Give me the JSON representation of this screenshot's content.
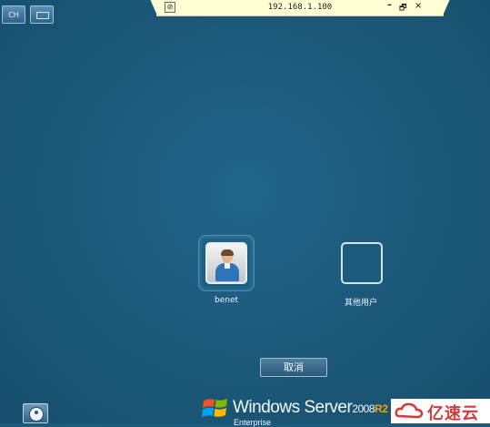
{
  "topbar": {
    "lang_label": "CH",
    "keyboard_icon": "keyboard-icon"
  },
  "connection_bar": {
    "pin_icon": "pin-icon",
    "title": "192.168.1.100",
    "minimize_label": "–",
    "restore_label": "🗗",
    "close_label": "×"
  },
  "users": [
    {
      "name": "benet",
      "icon": "user-avatar-icon"
    },
    {
      "name": "其他用户",
      "icon": "empty-user-tile"
    }
  ],
  "cancel_label": "取消",
  "ease_of_access_icon": "ease-of-access-icon",
  "branding": {
    "product": "Windows Server",
    "version": "2008",
    "release": "R2",
    "edition": "Enterprise",
    "r2_color": "#e5a12a"
  },
  "watermark": {
    "text": "亿速云",
    "color": "#d6393a"
  },
  "colors": {
    "background": "#1d5b7d",
    "connection_bar": "#ffffd6"
  }
}
